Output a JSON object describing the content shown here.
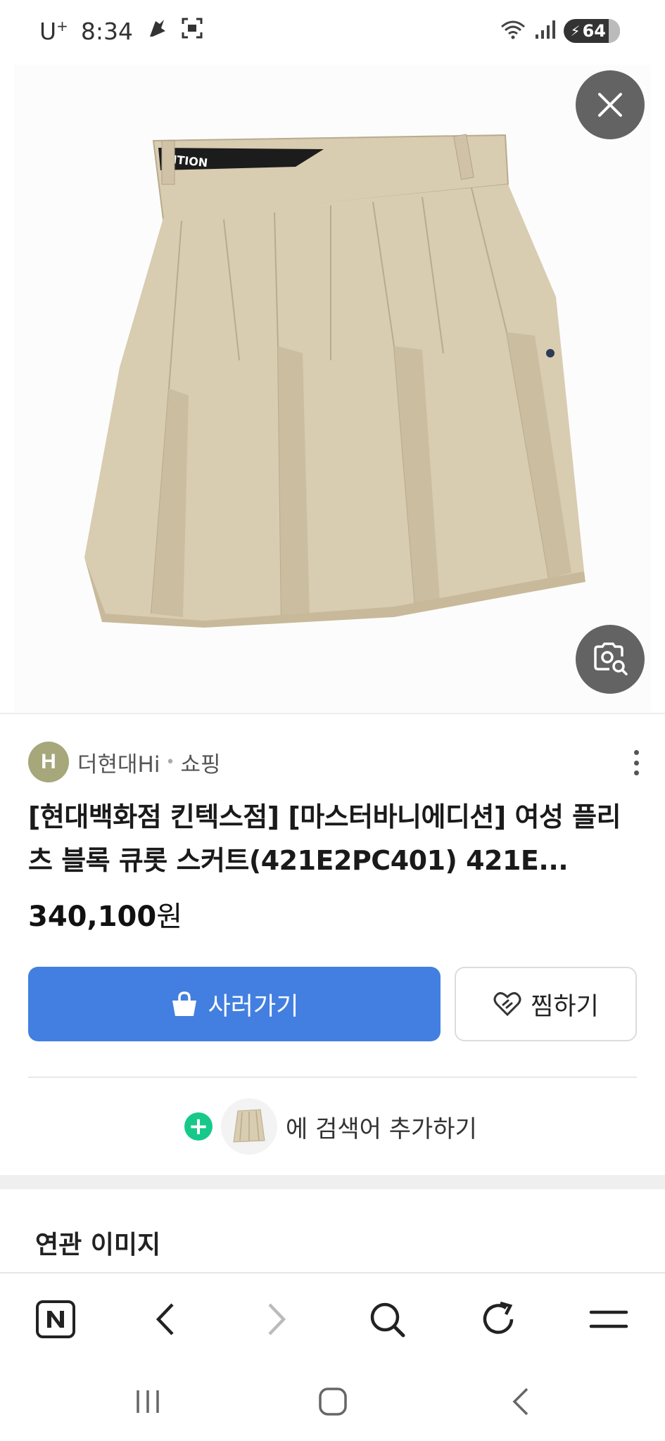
{
  "status_bar": {
    "carrier": "U",
    "carrier_sup": "+",
    "time": "8:34",
    "battery": "64"
  },
  "product_image": {
    "description_icon": "skirt-image",
    "waistband_text": "ITION"
  },
  "buttons": {
    "close_icon": "close-icon",
    "lens_icon": "image-search-icon"
  },
  "source": {
    "avatar_letter": "H",
    "name": "더현대Hi",
    "separator": "•",
    "category": "쇼핑"
  },
  "product": {
    "title": "[현대백화점 킨텍스점] [마스터바니에디션] 여성 플리츠 블록 큐롯 스커트(421E2PC401) 421E...",
    "price_number": "340,100",
    "price_unit": "원"
  },
  "actions": {
    "buy_label": "사러가기",
    "wish_label": "찜하기",
    "add_keyword_label": "에 검색어 추가하기"
  },
  "related": {
    "title": "연관 이미지"
  },
  "colors": {
    "buy_button": "#437fe0",
    "plus_icon": "#16c98a",
    "source_avatar": "#a6a77a",
    "skirt": "#d8ccb1"
  }
}
